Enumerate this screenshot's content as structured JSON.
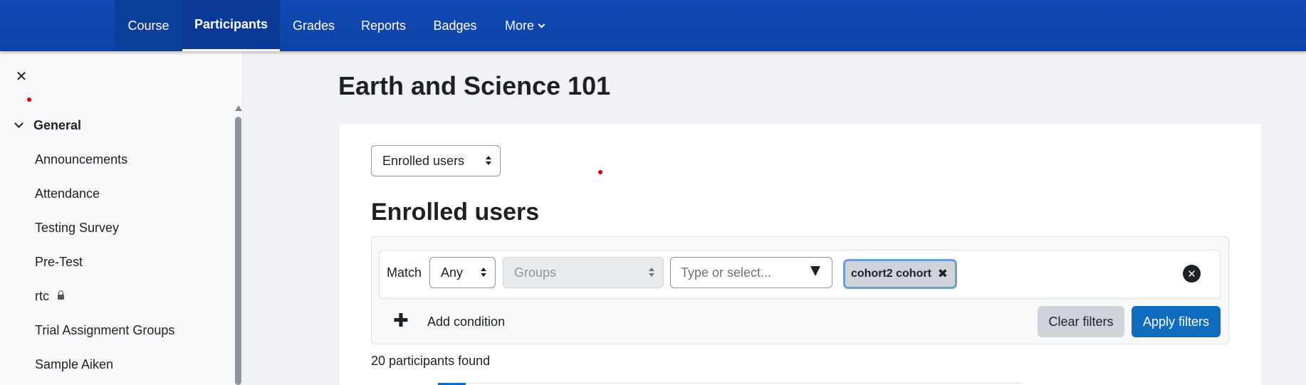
{
  "topnav": {
    "items": [
      {
        "label": "Course"
      },
      {
        "label": "Participants",
        "active": true
      },
      {
        "label": "Grades"
      },
      {
        "label": "Reports"
      },
      {
        "label": "Badges"
      },
      {
        "label": "More"
      }
    ]
  },
  "drawer": {
    "section": "General",
    "items": [
      {
        "label": "Announcements"
      },
      {
        "label": "Attendance"
      },
      {
        "label": "Testing Survey"
      },
      {
        "label": "Pre-Test"
      },
      {
        "label": "rtc",
        "icon": "lock-icon"
      },
      {
        "label": "Trial Assignment Groups"
      },
      {
        "label": "Sample Aiken"
      }
    ]
  },
  "main": {
    "page_title": "Earth and Science 101",
    "view_select": "Enrolled users",
    "section_title": "Enrolled users",
    "filter": {
      "match_label": "Match",
      "match_value": "Any",
      "type_value": "Groups",
      "value_placeholder": "Type or select...",
      "chip": "cohort2 cohort",
      "add_condition": "Add condition",
      "clear_label": "Clear filters",
      "apply_label": "Apply filters"
    },
    "found_text": "20 participants found"
  },
  "colors": {
    "navbar": "#0f47ad",
    "primary_button": "#0f6cbf",
    "secondary_button": "#ced4da",
    "chip_focus": "#6a9ed9"
  }
}
